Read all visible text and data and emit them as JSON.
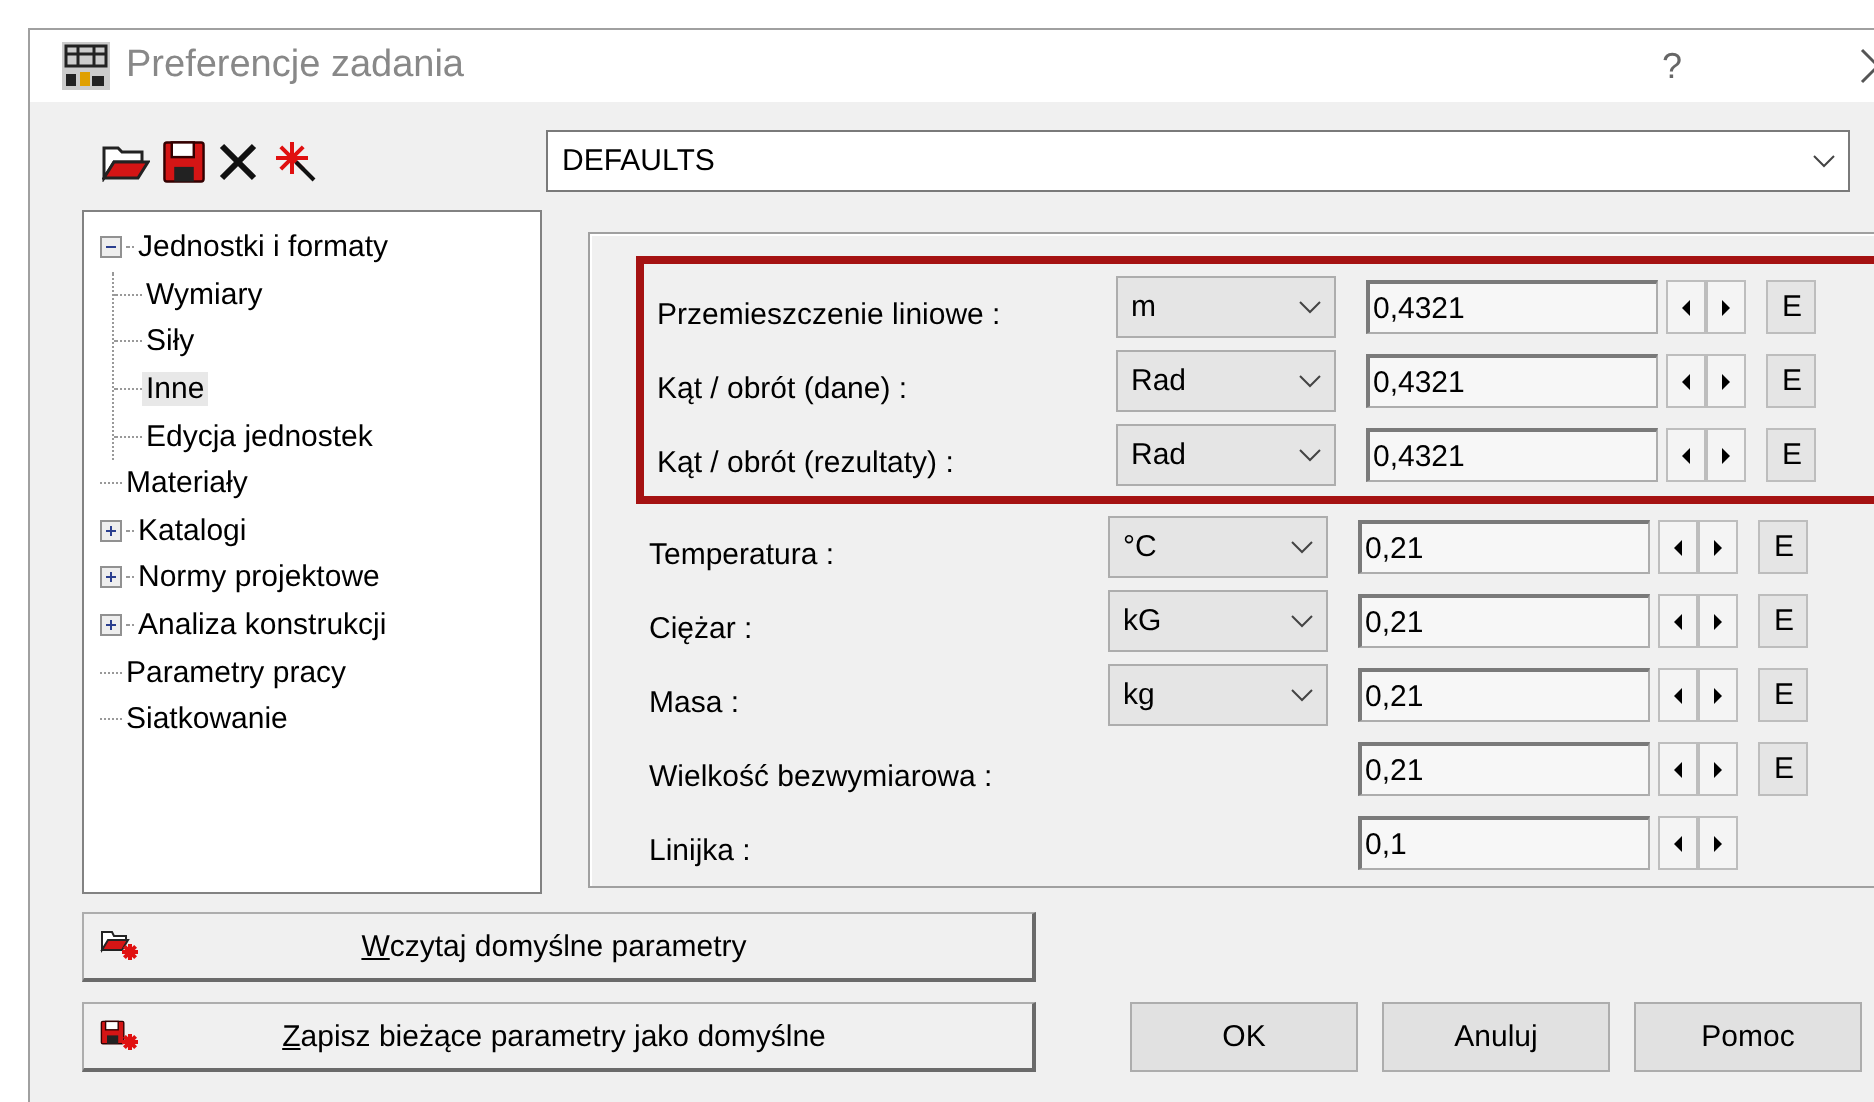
{
  "window": {
    "title": "Preferencje zadania",
    "help": "?"
  },
  "profile": {
    "value": "DEFAULTS"
  },
  "tree": [
    {
      "label": "Jednostki i formaty",
      "selected": false,
      "expanded": true,
      "children": [
        {
          "label": "Wymiary",
          "selected": false
        },
        {
          "label": "Siły",
          "selected": false
        },
        {
          "label": "Inne",
          "selected": true
        },
        {
          "label": "Edycja jednostek",
          "selected": false
        }
      ]
    },
    {
      "label": "Materiały",
      "selected": false
    },
    {
      "label": "Katalogi",
      "selected": false,
      "expanded": false
    },
    {
      "label": "Normy projektowe",
      "selected": false,
      "expanded": false
    },
    {
      "label": "Analiza konstrukcji",
      "selected": false,
      "expanded": false
    },
    {
      "label": "Parametry pracy",
      "selected": false
    },
    {
      "label": "Siatkowanie",
      "selected": false
    }
  ],
  "units": [
    {
      "label": "Przemieszczenie liniowe :",
      "unit": "m",
      "value": "0,4321",
      "edit": "E",
      "highlighted": true
    },
    {
      "label": "Kąt / obrót (dane) :",
      "unit": "Rad",
      "value": "0,4321",
      "edit": "E",
      "highlighted": true
    },
    {
      "label": "Kąt / obrót (rezultaty) :",
      "unit": "Rad",
      "value": "0,4321",
      "edit": "E",
      "highlighted": true
    },
    {
      "label": "Temperatura :",
      "unit": "°C",
      "value": "0,21",
      "edit": "E",
      "highlighted": false
    },
    {
      "label": "Ciężar :",
      "unit": "kG",
      "value": "0,21",
      "edit": "E",
      "highlighted": false
    },
    {
      "label": "Masa :",
      "unit": "kg",
      "value": "0,21",
      "edit": "E",
      "highlighted": false
    },
    {
      "label": "Wielkość bezwymiarowa :",
      "value": "0,21",
      "edit": "E",
      "highlighted": false
    },
    {
      "label": "Linijka :",
      "value": "0,1",
      "highlighted": false
    }
  ],
  "default_buttons": [
    {
      "kind": "load",
      "accel": "W",
      "rest": "czytaj domyślne parametry"
    },
    {
      "kind": "save",
      "accel": "Z",
      "rest": "apisz bieżące parametry jako domyślne"
    }
  ],
  "buttons": [
    "OK",
    "Anuluj",
    "Pomoc"
  ]
}
